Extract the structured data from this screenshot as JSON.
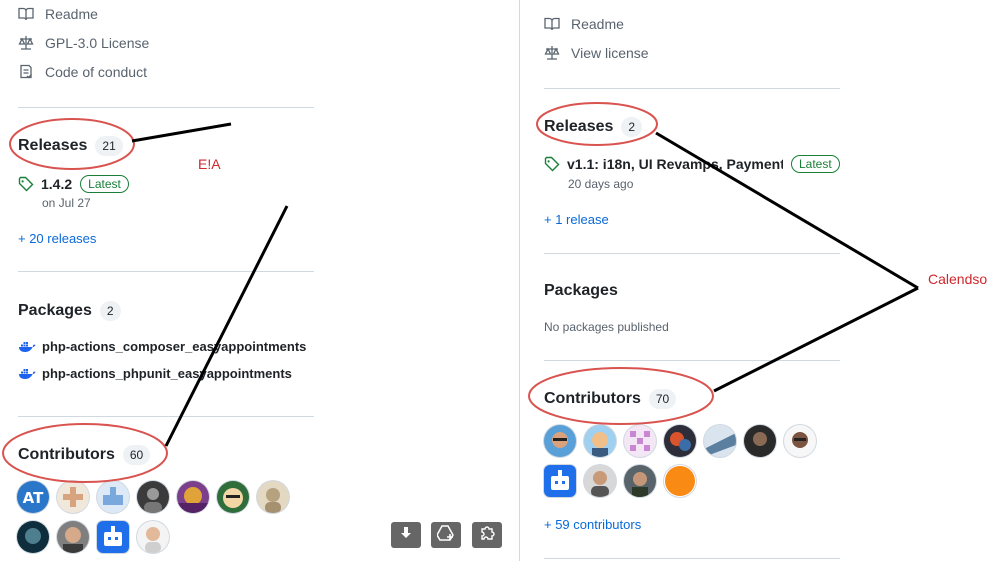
{
  "left": {
    "links": [
      "Readme",
      "GPL-3.0 License",
      "Code of conduct"
    ],
    "releases": {
      "title": "Releases",
      "count": "21",
      "version": "1.4.2",
      "badge": "Latest",
      "date": "on Jul 27",
      "more": "+ 20 releases"
    },
    "packages": {
      "title": "Packages",
      "count": "2",
      "items": [
        "php-actions_composer_easyappointments",
        "php-actions_phpunit_easyappointments"
      ]
    },
    "contributors": {
      "title": "Contributors",
      "count": "60"
    }
  },
  "right": {
    "links": [
      "Readme",
      "View license"
    ],
    "releases": {
      "title": "Releases",
      "count": "2",
      "version": "v1.1: i18n, UI Revamps, Payment...",
      "badge": "Latest",
      "date": "20 days ago",
      "more": "+ 1 release"
    },
    "packages": {
      "title": "Packages",
      "empty": "No packages published"
    },
    "contributors": {
      "title": "Contributors",
      "count": "70",
      "more": "+ 59 contributors"
    }
  },
  "annotations": {
    "left_label": "E!A",
    "right_label": "Calendso"
  },
  "icons": [
    "book-icon",
    "scale-icon",
    "code-of-conduct-icon",
    "tag-icon",
    "docker-icon",
    "download-icon",
    "add-drive-icon",
    "puzzle-icon"
  ],
  "colors": {
    "link": "#0969da",
    "latest": "#1a7f37",
    "annotation": "#d0272d",
    "muted": "#59636e"
  }
}
